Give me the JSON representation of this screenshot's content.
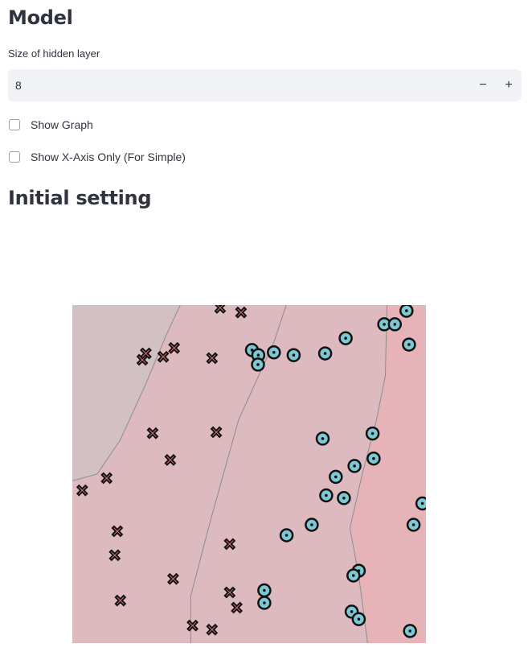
{
  "model_section": {
    "title": "Model",
    "hidden_layer_label": "Size of hidden layer",
    "hidden_layer_value": "8",
    "minus_label": "−",
    "plus_label": "+"
  },
  "options": {
    "show_graph_label": "Show Graph",
    "show_graph_checked": false,
    "show_xaxis_label": "Show X-Axis Only (For Simple)",
    "show_xaxis_checked": false
  },
  "initial_section": {
    "title": "Initial setting"
  },
  "chart_data": {
    "type": "scatter",
    "title": "",
    "xlabel": "",
    "ylabel": "",
    "grid": false,
    "legend": "none",
    "xlim": [
      0,
      1
    ],
    "ylim": [
      0,
      1
    ],
    "colors": {
      "region_1": "#d3c0c4",
      "region_2": "#dcbac0",
      "region_3": "#e6b4b8",
      "boundary": "#8c8c8c",
      "class_x": "#f08080",
      "class_o": "#7ec8d3",
      "outline": "#111111"
    },
    "decision_boundaries": [
      [
        [
          0.0,
          0.48
        ],
        [
          0.07,
          0.5
        ],
        [
          0.135,
          0.6
        ],
        [
          0.205,
          0.76
        ],
        [
          0.265,
          0.91
        ],
        [
          0.305,
          1.0
        ]
      ],
      [
        [
          0.335,
          0.0
        ],
        [
          0.335,
          0.14
        ],
        [
          0.39,
          0.36
        ],
        [
          0.47,
          0.66
        ],
        [
          0.57,
          0.89
        ],
        [
          0.605,
          1.0
        ]
      ],
      [
        [
          0.835,
          0.0
        ],
        [
          0.81,
          0.2
        ],
        [
          0.785,
          0.34
        ],
        [
          0.82,
          0.5
        ],
        [
          0.86,
          0.66
        ],
        [
          0.885,
          0.79
        ],
        [
          0.89,
          1.0
        ]
      ]
    ],
    "series": [
      {
        "marker": "x",
        "points": [
          [
            0.418,
            0.992
          ],
          [
            0.477,
            0.978
          ],
          [
            0.198,
            0.838
          ],
          [
            0.208,
            0.857
          ],
          [
            0.257,
            0.847
          ],
          [
            0.288,
            0.873
          ],
          [
            0.395,
            0.843
          ],
          [
            0.227,
            0.621
          ],
          [
            0.407,
            0.624
          ],
          [
            0.277,
            0.542
          ],
          [
            0.097,
            0.488
          ],
          [
            0.028,
            0.452
          ],
          [
            0.127,
            0.331
          ],
          [
            0.12,
            0.26
          ],
          [
            0.285,
            0.19
          ],
          [
            0.136,
            0.126
          ],
          [
            0.445,
            0.293
          ],
          [
            0.445,
            0.15
          ],
          [
            0.465,
            0.105
          ],
          [
            0.34,
            0.052
          ],
          [
            0.395,
            0.04
          ]
        ]
      },
      {
        "marker": "o",
        "points": [
          [
            0.945,
            0.983
          ],
          [
            0.882,
            0.943
          ],
          [
            0.912,
            0.943
          ],
          [
            0.952,
            0.883
          ],
          [
            0.773,
            0.902
          ],
          [
            0.715,
            0.857
          ],
          [
            0.57,
            0.86
          ],
          [
            0.508,
            0.867
          ],
          [
            0.526,
            0.852
          ],
          [
            0.525,
            0.824
          ],
          [
            0.626,
            0.852
          ],
          [
            0.708,
            0.605
          ],
          [
            0.849,
            0.62
          ],
          [
            0.852,
            0.546
          ],
          [
            0.798,
            0.524
          ],
          [
            0.745,
            0.492
          ],
          [
            0.718,
            0.437
          ],
          [
            0.768,
            0.429
          ],
          [
            0.99,
            0.413
          ],
          [
            0.965,
            0.35
          ],
          [
            0.677,
            0.35
          ],
          [
            0.606,
            0.319
          ],
          [
            0.81,
            0.214
          ],
          [
            0.795,
            0.2
          ],
          [
            0.543,
            0.156
          ],
          [
            0.543,
            0.119
          ],
          [
            0.79,
            0.093
          ],
          [
            0.81,
            0.071
          ],
          [
            0.955,
            0.036
          ]
        ]
      }
    ]
  }
}
